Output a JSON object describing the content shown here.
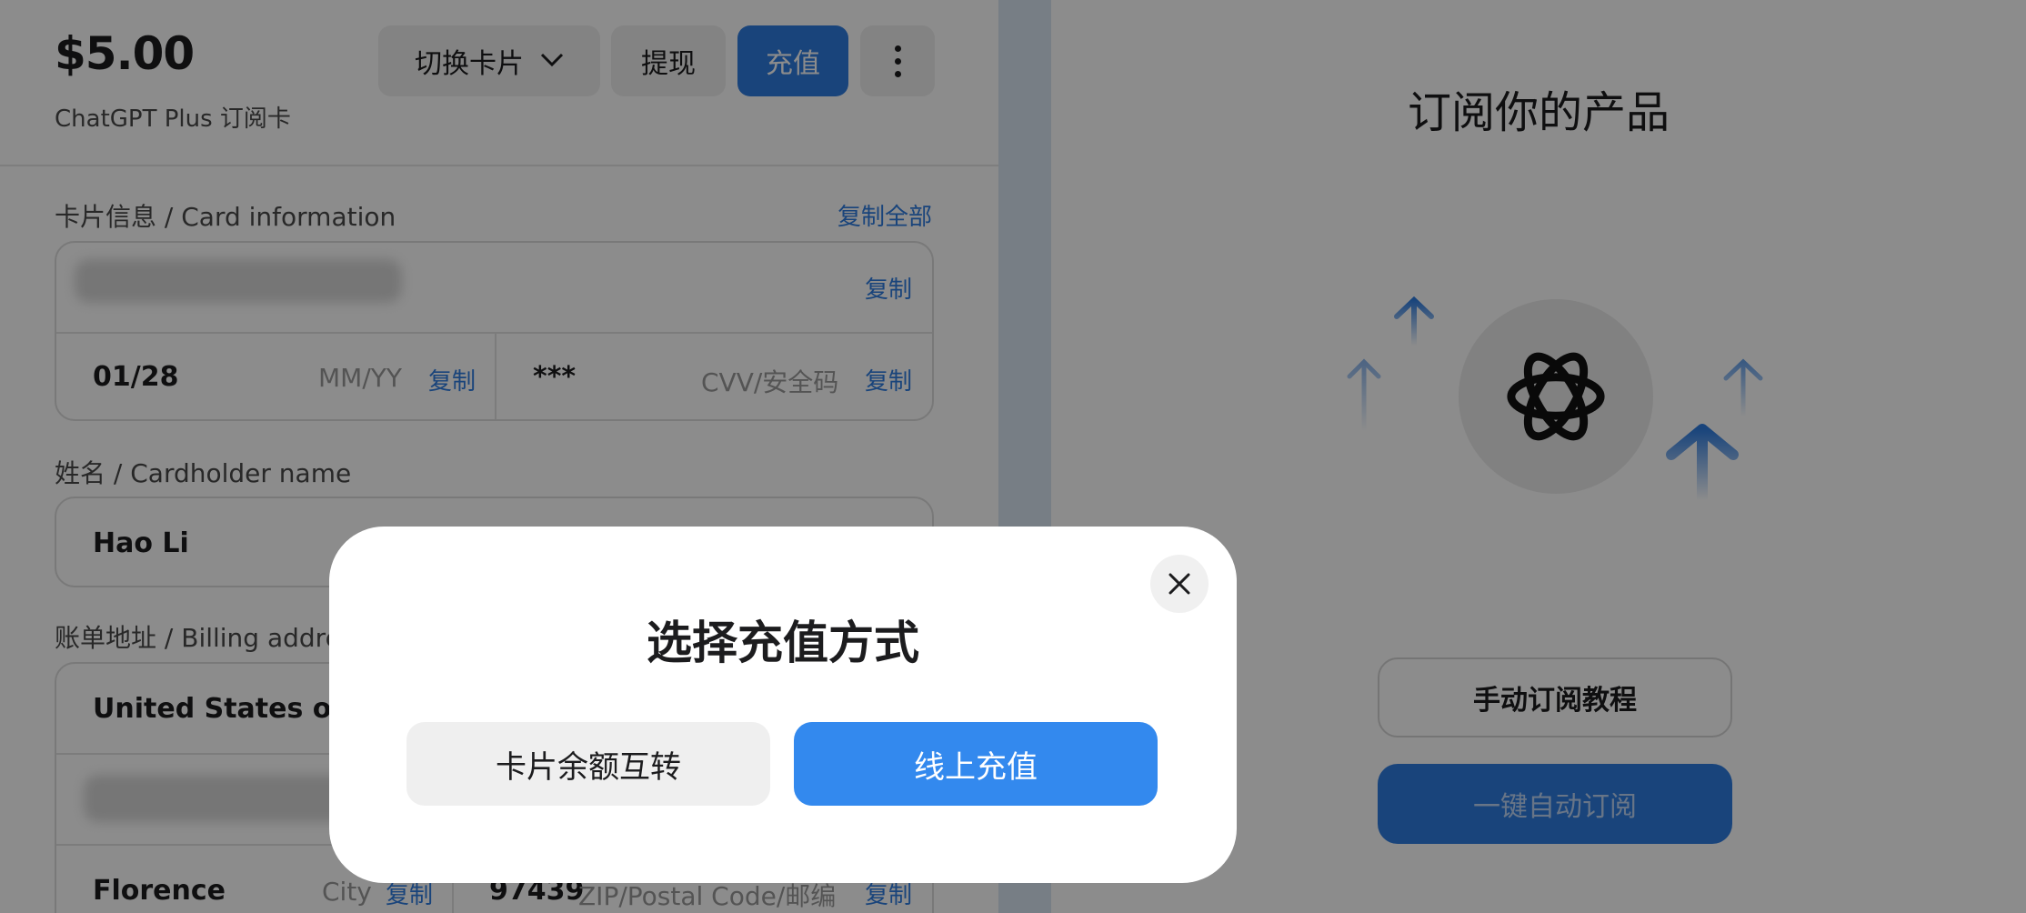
{
  "card": {
    "balance": "$5.00",
    "name": "ChatGPT Plus 订阅卡"
  },
  "toolbar": {
    "switch_card_label": "切换卡片",
    "withdraw_label": "提现",
    "recharge_label": "充值"
  },
  "card_info": {
    "section_label": "卡片信息 / Card information",
    "copy_all_label": "复制全部",
    "copy_label": "复制",
    "expiry_value": "01/28",
    "expiry_placeholder": "MM/YY",
    "cvv_value": "***",
    "cvv_placeholder": "CVV/安全码"
  },
  "cardholder": {
    "section_label": "姓名 / Cardholder name",
    "value": "Hao Li"
  },
  "billing": {
    "section_label": "账单地址 / Billing address",
    "country_value": "United States of America",
    "city_value": "Florence",
    "city_placeholder": "City",
    "zip_value": "97439",
    "zip_placeholder": "ZIP/Postal Code/邮编",
    "copy_label": "复制"
  },
  "right_panel": {
    "title": "订阅你的产品",
    "tutorial_button": "手动订阅教程",
    "auto_subscribe_button": "一键自动订阅"
  },
  "modal": {
    "title": "选择充值方式",
    "transfer_button": "卡片余额互转",
    "online_button": "线上充值"
  },
  "colors": {
    "accent": "#2f7de1",
    "modal_primary": "#3389ee"
  }
}
